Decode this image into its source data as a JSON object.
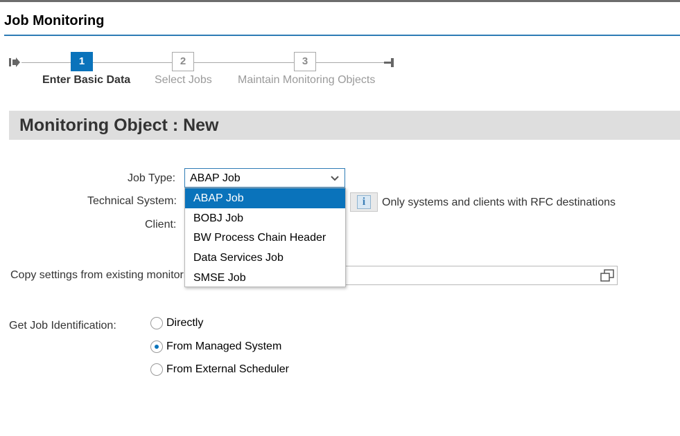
{
  "app": {
    "title": "Job Monitoring"
  },
  "colors": {
    "accent": "#0a73bb",
    "title_rule": "#2d7bb5",
    "section_bg": "#dedede"
  },
  "roadmap": {
    "steps": [
      {
        "number": "1",
        "label": "Enter Basic Data",
        "state": "active"
      },
      {
        "number": "2",
        "label": "Select Jobs",
        "state": "inactive"
      },
      {
        "number": "3",
        "label": "Maintain Monitoring Objects",
        "state": "inactive"
      }
    ],
    "start_icon": "roadmap-start-icon",
    "end_icon": "roadmap-end-icon"
  },
  "section": {
    "title": "Monitoring Object : New"
  },
  "form": {
    "job_type_label": "Job Type:",
    "job_type_value": "ABAP Job",
    "technical_system_label": "Technical System:",
    "client_label": "Client:",
    "info_icon": "info-icon",
    "rfc_note": "Only systems and clients with RFC destinations",
    "copy_settings_label": "Copy settings from existing monitorir",
    "value_help_icon": "value-help-icon"
  },
  "dropdown": {
    "options": [
      "ABAP Job",
      "BOBJ Job",
      "BW Process Chain Header",
      "Data Services Job",
      "SMSE Job"
    ],
    "selected": "ABAP Job"
  },
  "identification": {
    "label": "Get Job Identification:",
    "options": [
      {
        "label": "Directly",
        "checked": false
      },
      {
        "label": "From Managed System",
        "checked": true
      },
      {
        "label": "From External Scheduler",
        "checked": false
      }
    ]
  }
}
